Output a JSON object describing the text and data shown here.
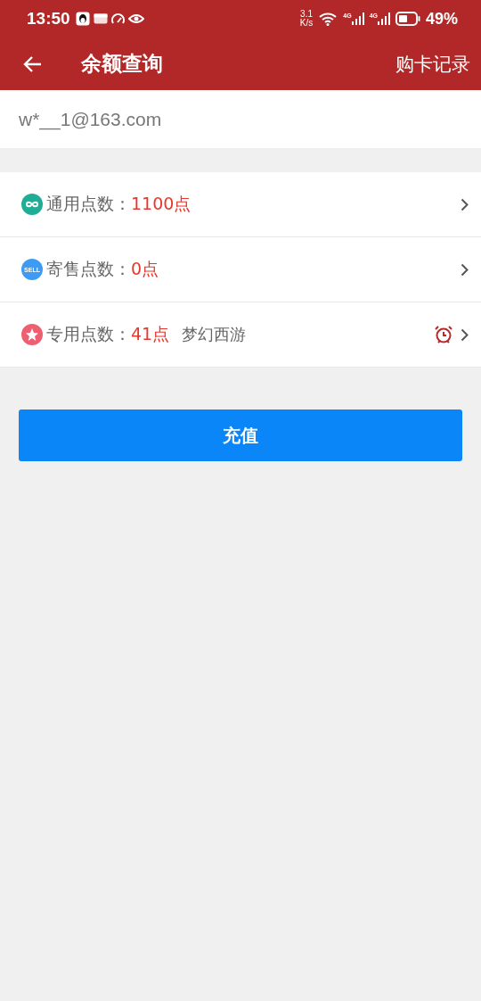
{
  "status_bar": {
    "time": "13:50",
    "speed_value": "3.1",
    "speed_unit": "K/s",
    "networks": [
      "4G",
      "4G"
    ],
    "battery": "49%"
  },
  "header": {
    "title": "余额查询",
    "action": "购卡记录"
  },
  "account": {
    "email": "w*__1@163.com"
  },
  "balances": [
    {
      "kind": "infinity",
      "label": "通用点数：",
      "value": "1100点",
      "alarm": false
    },
    {
      "kind": "sell",
      "icon_text": "SELL",
      "label": "寄售点数：",
      "value": "0点",
      "alarm": false
    },
    {
      "kind": "star",
      "label": "专用点数：",
      "value": "41点",
      "note": "梦幻西游",
      "alarm": true
    }
  ],
  "recharge_button": "充值"
}
